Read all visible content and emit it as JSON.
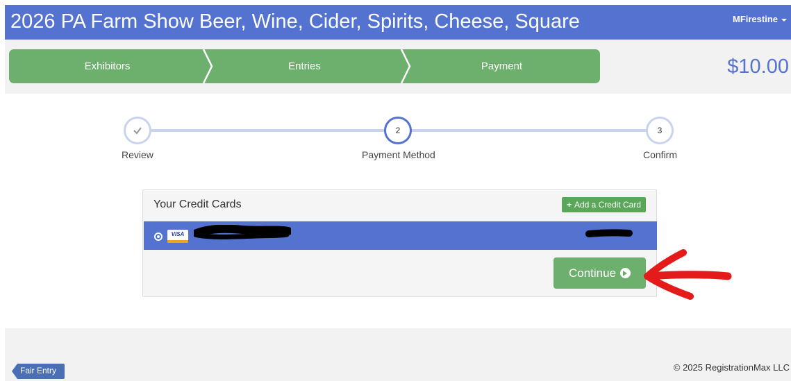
{
  "header": {
    "title": "2026 PA Farm Show Beer, Wine, Cider, Spirits, Cheese, Square",
    "user": "MFirestine"
  },
  "steps": {
    "items": [
      {
        "label": "Exhibitors"
      },
      {
        "label": "Entries"
      },
      {
        "label": "Payment"
      }
    ],
    "color": "#6db06d"
  },
  "total": "$10.00",
  "wizard": {
    "steps": [
      {
        "num": "",
        "label": "Review",
        "state": "done"
      },
      {
        "num": "2",
        "label": "Payment Method",
        "state": "active"
      },
      {
        "num": "3",
        "label": "Confirm",
        "state": "todo"
      }
    ]
  },
  "cards": {
    "title": "Your Credit Cards",
    "add_label": "Add a Credit Card",
    "rows": [
      {
        "brand": "VISA"
      }
    ]
  },
  "continue_label": "Continue",
  "footer": {
    "logo": "Fair Entry",
    "copyright": "© 2025 RegistrationMax LLC"
  },
  "colors": {
    "primary": "#5472cf",
    "success": "#6db06d",
    "annotation": "#e41b1b"
  }
}
